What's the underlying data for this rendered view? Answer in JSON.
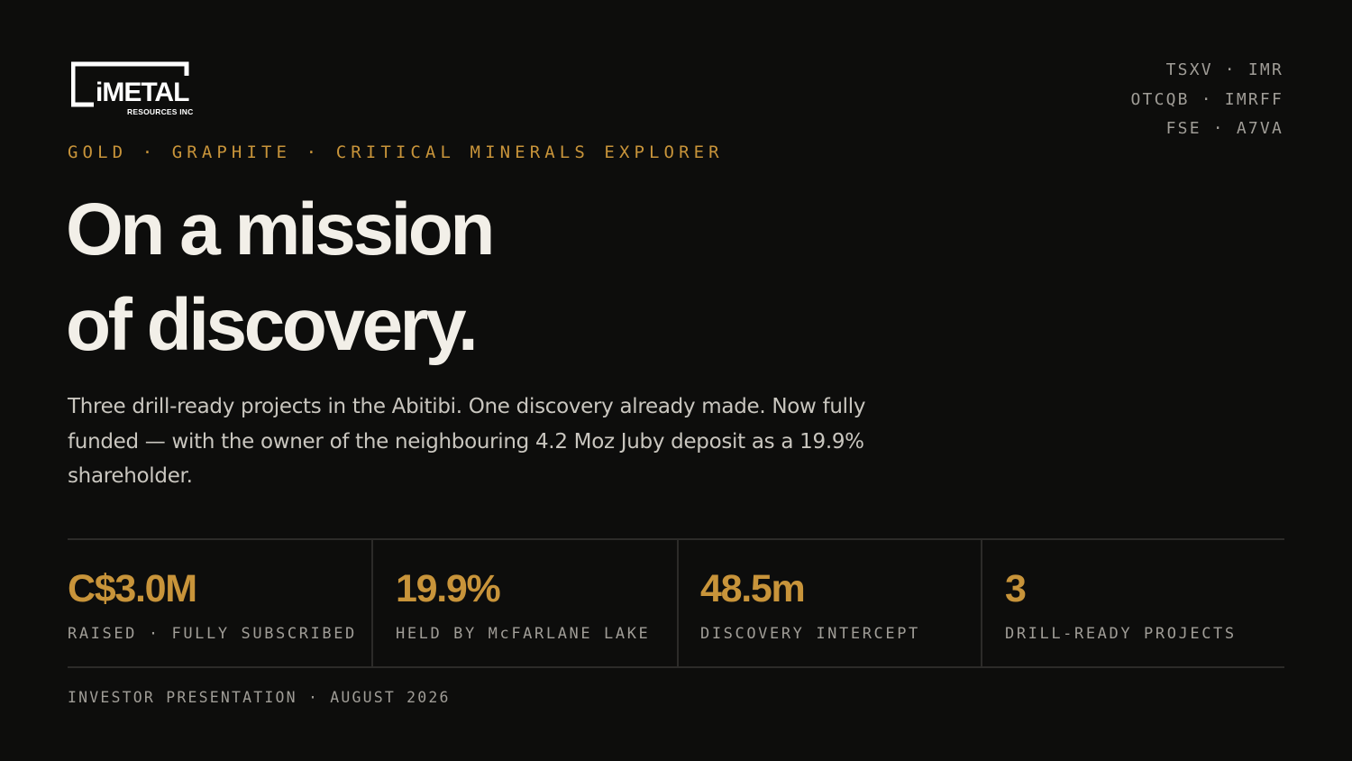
{
  "logo": {
    "wordmark": "iMETAL",
    "subline": "RESOURCES INC",
    "color": "#ffffff"
  },
  "tickers": [
    "TSXV · IMR",
    "OTCQB · IMRFF",
    "FSE · A7VA"
  ],
  "eyebrow": "GOLD · GRAPHITE · CRITICAL MINERALS EXPLORER",
  "headline": {
    "line1": "On a mission",
    "line2": "of discovery."
  },
  "subtext": "Three drill-ready projects in the Abitibi. One discovery already made. Now fully funded — with the owner of the neighbouring 4.2 Moz Juby deposit as a 19.9% shareholder.",
  "stats": [
    {
      "value": "C$3.0M",
      "label": "RAISED · FULLY SUBSCRIBED"
    },
    {
      "value": "19.9%",
      "label": "HELD BY McFARLANE LAKE"
    },
    {
      "value": "48.5m",
      "label": "DISCOVERY INTERCEPT"
    },
    {
      "value": "3",
      "label": "DRILL-READY PROJECTS"
    }
  ],
  "footer": "INVESTOR PRESENTATION · AUGUST 2026",
  "colors": {
    "background": "#0d0d0c",
    "accent": "#c8943a",
    "text": "#f2efe8",
    "muted": "#a09d97"
  }
}
